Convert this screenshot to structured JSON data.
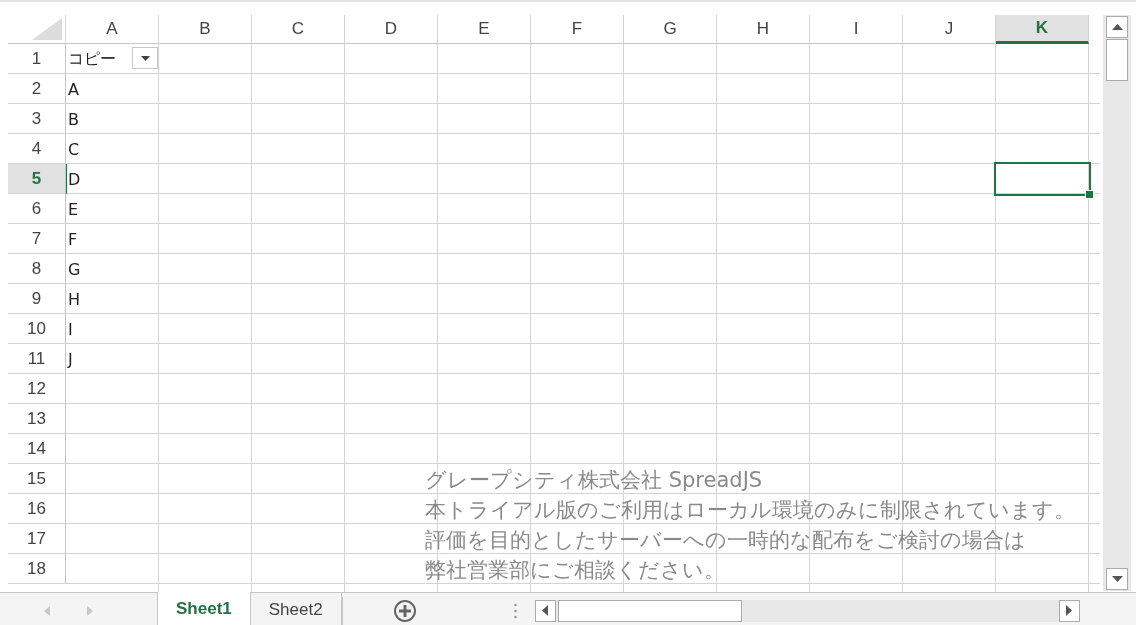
{
  "columns": [
    {
      "label": "A",
      "selected": false
    },
    {
      "label": "B",
      "selected": false
    },
    {
      "label": "C",
      "selected": false
    },
    {
      "label": "D",
      "selected": false
    },
    {
      "label": "E",
      "selected": false
    },
    {
      "label": "F",
      "selected": false
    },
    {
      "label": "G",
      "selected": false
    },
    {
      "label": "H",
      "selected": false
    },
    {
      "label": "I",
      "selected": false
    },
    {
      "label": "J",
      "selected": false
    },
    {
      "label": "K",
      "selected": true
    }
  ],
  "rows": [
    {
      "label": "1",
      "selected": false,
      "cell_a": "コピー",
      "filter": true
    },
    {
      "label": "2",
      "selected": false,
      "cell_a": "A"
    },
    {
      "label": "3",
      "selected": false,
      "cell_a": "B"
    },
    {
      "label": "4",
      "selected": false,
      "cell_a": "C"
    },
    {
      "label": "5",
      "selected": true,
      "cell_a": "D"
    },
    {
      "label": "6",
      "selected": false,
      "cell_a": "E"
    },
    {
      "label": "7",
      "selected": false,
      "cell_a": "F"
    },
    {
      "label": "8",
      "selected": false,
      "cell_a": "G"
    },
    {
      "label": "9",
      "selected": false,
      "cell_a": "H"
    },
    {
      "label": "10",
      "selected": false,
      "cell_a": "I"
    },
    {
      "label": "11",
      "selected": false,
      "cell_a": "J"
    },
    {
      "label": "12",
      "selected": false
    },
    {
      "label": "13",
      "selected": false
    },
    {
      "label": "14",
      "selected": false
    },
    {
      "label": "15",
      "selected": false
    },
    {
      "label": "16",
      "selected": false
    },
    {
      "label": "17",
      "selected": false
    },
    {
      "label": "18",
      "selected": false
    }
  ],
  "trial_notice": [
    "グレープシティ株式会社 SpreadJS",
    "本トライアル版のご利用はローカル環境のみに制限されています。",
    "評価を目的としたサーバーへの一時的な配布をご検討の場合は",
    "弊社営業部にご相談ください。"
  ],
  "sheet_tabs": [
    {
      "label": "Sheet1",
      "selected": true
    },
    {
      "label": "Sheet2",
      "selected": false
    }
  ]
}
